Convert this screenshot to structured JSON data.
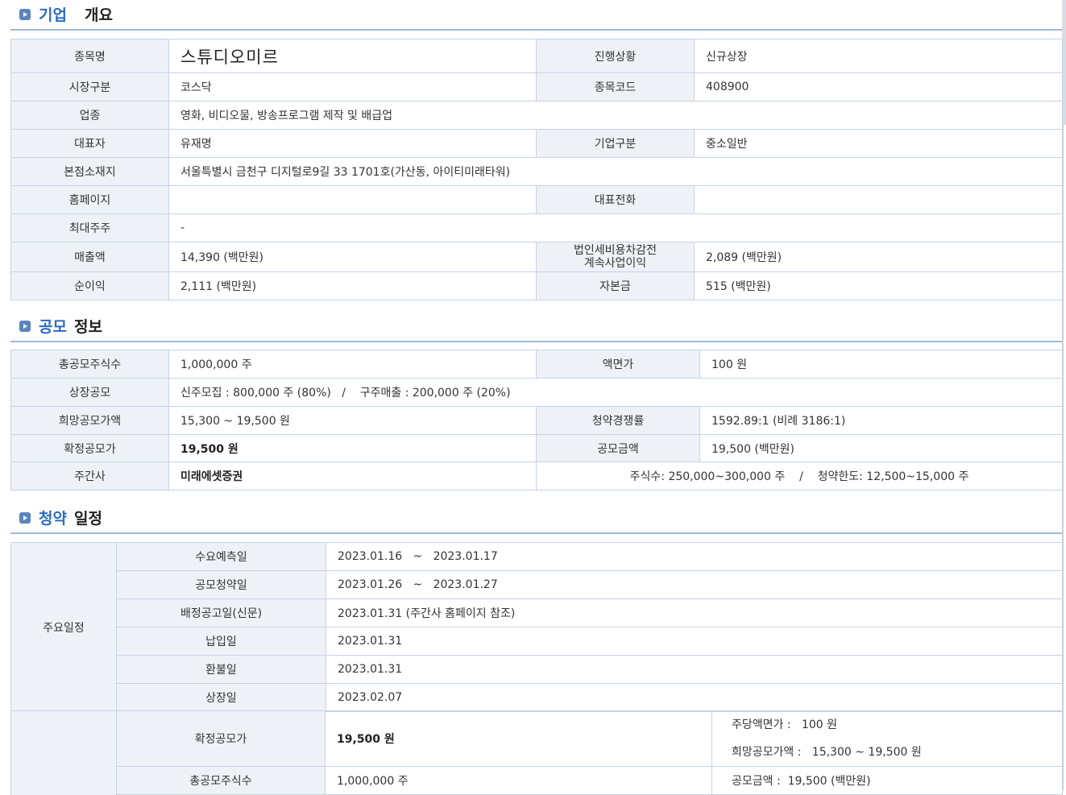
{
  "sections": {
    "company": {
      "t1": "기업",
      "t2": "개요"
    },
    "offering": {
      "t1": "공모",
      "t2": "정보"
    },
    "schedule": {
      "t1": "청약",
      "t2": "일정"
    }
  },
  "company": {
    "name_label": "종목명",
    "name": "스튜디오미르",
    "status_label": "진행상황",
    "status": "신규상장",
    "market_label": "시장구분",
    "market": "코스닥",
    "code_label": "종목코드",
    "code": "408900",
    "industry_label": "업종",
    "industry": "영화, 비디오물, 방송프로그램 제작 및 배급업",
    "ceo_label": "대표자",
    "ceo": "유재명",
    "type_label": "기업구분",
    "type": "중소일반",
    "address_label": "본점소재지",
    "address": "서울특별시 금천구 디지털로9길 33 1701호(가산동, 아이티미래타워)",
    "homepage_label": "홈페이지",
    "homepage": "",
    "phone_label": "대표전화",
    "phone": "",
    "shareholder_label": "최대주주",
    "shareholder": "-",
    "revenue_label": "매출액",
    "revenue": "14,390 (백만원)",
    "pretax_label_1": "법인세비용차감전",
    "pretax_label_2": "계속사업이익",
    "pretax": "2,089 (백만원)",
    "netincome_label": "순이익",
    "netincome": "2,111 (백만원)",
    "capital_label": "자본금",
    "capital": "515 (백만원)"
  },
  "offering": {
    "total_shares_label": "총공모주식수",
    "total_shares": "1,000,000 주",
    "face_value_label": "액면가",
    "face_value": "100 원",
    "listing_offer_label": "상장공모",
    "listing_offer": "신주모집 : 800,000 주 (80%)   /    구주매출 : 200,000 주 (20%)",
    "desired_price_label": "희망공모가액",
    "desired_price": "15,300 ~ 19,500 원",
    "competition_label": "청약경쟁률",
    "competition": "1592.89:1 (비례 3186:1)",
    "final_price_label": "확정공모가",
    "final_price": "19,500 원",
    "offer_amount_label": "공모금액",
    "offer_amount": "19,500 (백만원)",
    "underwriter_label": "주간사",
    "underwriter": "미래에셋증권",
    "underwriter_info": "주식수: 250,000~300,000 주    /    청약한도: 12,500~15,000 주"
  },
  "schedule": {
    "group_label": "주요일정",
    "rows": [
      {
        "label": "수요예측일",
        "value": "2023.01.16   ~   2023.01.17"
      },
      {
        "label": "공모청약일",
        "value": "2023.01.26   ~   2023.01.27"
      },
      {
        "label": "배정공고일(신문)",
        "value": "2023.01.31 (주간사 홈페이지 참조)"
      },
      {
        "label": "납입일",
        "value": "2023.01.31"
      },
      {
        "label": "환불일",
        "value": "2023.01.31"
      },
      {
        "label": "상장일",
        "value": "2023.02.07"
      }
    ],
    "final_price_label": "확정공모가",
    "final_price": "19,500 원",
    "face_per_share": "주당액면가 :   100 원",
    "desired_price": "희망공모가액 :   15,300 ~ 19,500 원",
    "total_shares_label": "총공모주식수",
    "total_shares": "1,000,000 주",
    "offer_amount": "공모금액 :  19,500 (백만원)"
  }
}
